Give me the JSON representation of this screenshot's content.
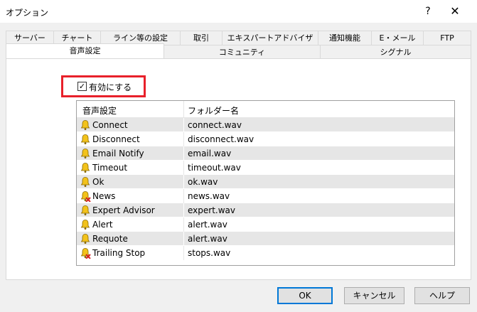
{
  "window": {
    "title": "オプション",
    "help_glyph": "?",
    "close_glyph": "✕"
  },
  "tabs_row1": [
    "サーバー",
    "チャート",
    "ライン等の設定",
    "取引",
    "エキスパートアドバイザ",
    "通知機能",
    "E・メール",
    "FTP"
  ],
  "tabs_row2": [
    "音声設定",
    "コミュニティ",
    "シグナル"
  ],
  "active_tab": "音声設定",
  "enable": {
    "label": "有効にする",
    "checked": true
  },
  "list": {
    "headers": [
      "音声設定",
      "フォルダー名"
    ],
    "rows": [
      {
        "name": "Connect",
        "file": "connect.wav",
        "icon": "bell-icon"
      },
      {
        "name": "Disconnect",
        "file": "disconnect.wav",
        "icon": "bell-icon"
      },
      {
        "name": "Email Notify",
        "file": "email.wav",
        "icon": "bell-icon"
      },
      {
        "name": "Timeout",
        "file": "timeout.wav",
        "icon": "bell-icon"
      },
      {
        "name": "Ok",
        "file": "ok.wav",
        "icon": "bell-icon"
      },
      {
        "name": "News",
        "file": "news.wav",
        "icon": "bell-disabled-icon"
      },
      {
        "name": "Expert Advisor",
        "file": "expert.wav",
        "icon": "bell-icon"
      },
      {
        "name": "Alert",
        "file": "alert.wav",
        "icon": "bell-icon"
      },
      {
        "name": "Requote",
        "file": "alert.wav",
        "icon": "bell-icon"
      },
      {
        "name": "Trailing Stop",
        "file": "stops.wav",
        "icon": "bell-disabled-icon"
      }
    ]
  },
  "buttons": {
    "ok": "OK",
    "cancel": "キャンセル",
    "help": "ヘルプ"
  },
  "colors": {
    "highlight_border": "#e8202a",
    "default_button_border": "#0078d7",
    "bell": "#f2c21b",
    "disabled_mark": "#d42020"
  }
}
